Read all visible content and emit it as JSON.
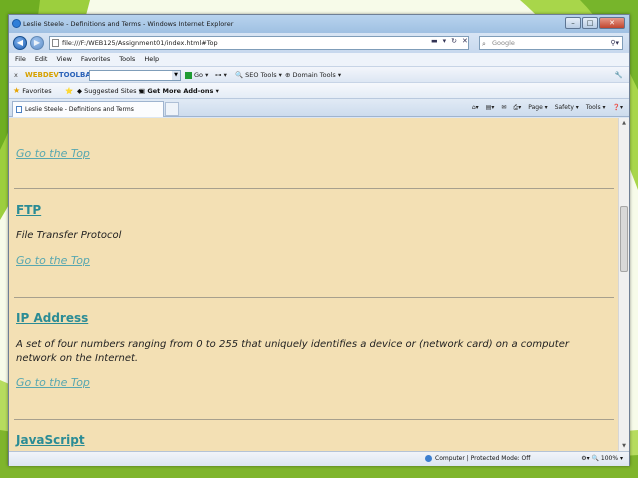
{
  "browser": {
    "title": "Leslie Steele - Definitions and Terms - Windows Internet Explorer",
    "address": "file:///F:/WEB125/Assignment01/index.html#Top",
    "search_placeholder": "Google",
    "menu": [
      "File",
      "Edit",
      "View",
      "Favorites",
      "Tools",
      "Help"
    ],
    "toolbar": {
      "webdev_logo_a": "WEBDEV",
      "webdev_logo_b": "TOOLBAR",
      "go_label": "Go",
      "seo_label": "SEO Tools",
      "domain_label": "Domain Tools"
    },
    "favorites": {
      "favorites_label": "Favorites",
      "suggested_label": "Suggested Sites ▾",
      "addons_label": "Get More Add-ons ▾"
    },
    "tab": {
      "label": "Leslie Steele - Definitions and Terms"
    },
    "commands": [
      "Page ▾",
      "Safety ▾",
      "Tools ▾"
    ],
    "status": {
      "zone": "Computer | Protected Mode: Off",
      "zoom": "100%"
    }
  },
  "page": {
    "go_top_label": "Go to the Top",
    "terms": [
      {
        "title": "FTP",
        "description": "File Transfer Protocol"
      },
      {
        "title": "IP Address",
        "description": "A set of four numbers ranging from 0 to 255 that uniquely identifies a device or (network card) on a computer network on the Internet."
      },
      {
        "title": "JavaScript",
        "description": ""
      }
    ]
  },
  "colors": {
    "page_background": "#f3e0b4",
    "link": "#58a7b0",
    "heading_link": "#2b8c95"
  }
}
